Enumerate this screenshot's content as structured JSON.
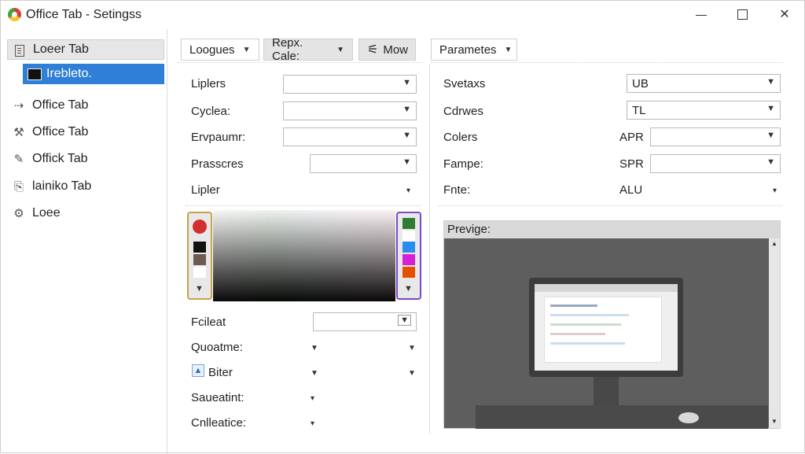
{
  "window": {
    "title": "Office Tab - Setingss"
  },
  "sidebar": {
    "items": [
      {
        "label": "Loeer Tab",
        "icon": "document-icon"
      },
      {
        "label": "Irebleto.",
        "icon": "window-icon"
      },
      {
        "label": "Office Tab",
        "icon": "arrow-branch-icon"
      },
      {
        "label": "Office Tab",
        "icon": "tools-icon"
      },
      {
        "label": "Offick Tab",
        "icon": "pen-icon"
      },
      {
        "label": "lainiko Tab",
        "icon": "page-icon"
      },
      {
        "label": "Loee",
        "icon": "gear-icon"
      }
    ]
  },
  "toolbar": {
    "loogues": "Loogues",
    "repx_cale": "Repx. Cale:",
    "mow": "Mow",
    "parameters": "Parametes"
  },
  "left_fields": {
    "liplers": "Liplers",
    "cyclea": "Cyclea:",
    "ervpaumr": "Ervpaumr:",
    "prasscres": "Prasscres",
    "lipler": "Lipler",
    "fcileat": "Fcileat",
    "quoatme": "Quoatme:",
    "biter": "Biter",
    "saueatint": "Saueatint:",
    "cnlleatice": "Cnlleatice:"
  },
  "right_fields": {
    "svetaxs": "Svetaxs",
    "svetaxs_value": "UB",
    "cdrwes": "Cdrwes",
    "cdrwes_value": "TL",
    "colers": "Colers",
    "colers_prefix": "APR",
    "fampe": "Fampe:",
    "fampe_prefix": "SPR",
    "fnte": "Fnte:",
    "fnte_value": "ALU"
  },
  "preview": {
    "title": "Previge:"
  },
  "colors": {
    "accent": "#2f7fd6",
    "swatches_left": [
      "#d32f2f",
      "#111111",
      "#6d5a52",
      "#ffffff"
    ],
    "swatches_right": [
      "#2e7d32",
      "#2a8cf0",
      "#d61fd6",
      "#e65100"
    ]
  }
}
